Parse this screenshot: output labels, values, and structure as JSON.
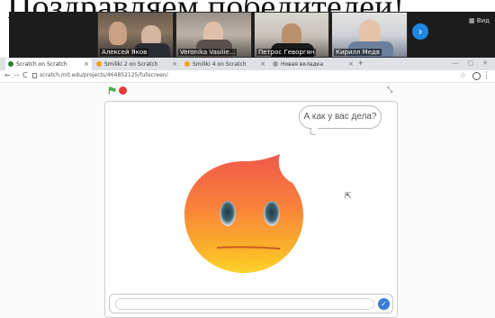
{
  "slide": {
    "title": "Поздравляем победителей!"
  },
  "conference": {
    "participants": [
      {
        "name": "Алексей Яков"
      },
      {
        "name": "Veronika Vasilie..."
      },
      {
        "name": "Петрос Геворгян"
      },
      {
        "name": "Кирилл Медв"
      }
    ],
    "next_icon": "chevron-right-icon",
    "menu_label": "Вид"
  },
  "browser": {
    "tabs": [
      {
        "label": "Scratch on Scratch",
        "active": true
      },
      {
        "label": "Smiliki 2 on Scratch",
        "active": false
      },
      {
        "label": "Smiliki 4 on Scratch",
        "active": false
      },
      {
        "label": "Новая вкладка",
        "active": false
      }
    ],
    "url": "scratch.mit.edu/projects/464852125/fullscreen/"
  },
  "stage": {
    "speech": "А как у вас дела?",
    "ask_placeholder": ""
  },
  "colors": {
    "accent_blue": "#1e88e5",
    "stop_red": "#e53935",
    "flag_green": "#4caf50"
  }
}
